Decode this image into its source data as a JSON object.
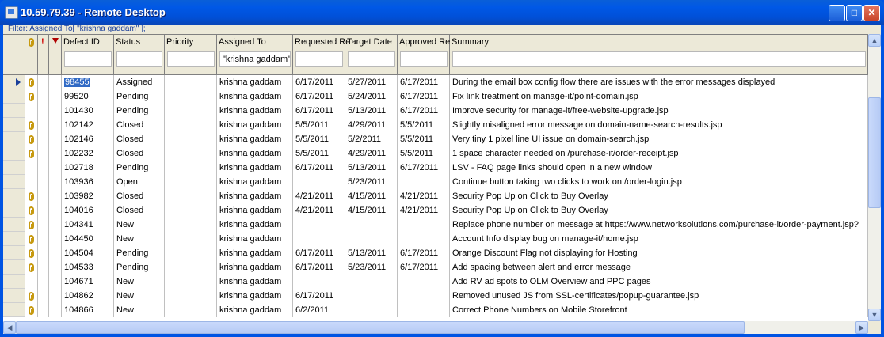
{
  "window": {
    "title": "10.59.79.39 - Remote Desktop",
    "minimize": "_",
    "maximize": "□",
    "close": "✕"
  },
  "filter": {
    "text": "Filter: Assigned To[ \"krishna gaddam\" ];"
  },
  "columns": [
    {
      "label": "",
      "icon": "attachment-icon"
    },
    {
      "label": "!",
      "icon": "priority-icon"
    },
    {
      "label": "",
      "icon": "flag-icon"
    },
    {
      "label": "Defect ID",
      "filter": ""
    },
    {
      "label": "Status",
      "filter": ""
    },
    {
      "label": "Priority",
      "filter": ""
    },
    {
      "label": "Assigned To",
      "filter": "\"krishna gaddam\""
    },
    {
      "label": "Requested Re",
      "filter": ""
    },
    {
      "label": "Target Date",
      "filter": ""
    },
    {
      "label": "Approved Re",
      "filter": ""
    },
    {
      "label": "Summary",
      "filter": ""
    }
  ],
  "rows": [
    {
      "attach": true,
      "id": "98455",
      "status": "Assigned",
      "priority": "",
      "assigned": "krishna gaddam",
      "requested": "6/17/2011",
      "target": "5/27/2011",
      "approved": "6/17/2011",
      "summary": "During the email box config flow there are issues with the error messages displayed"
    },
    {
      "attach": true,
      "id": "99520",
      "status": "Pending",
      "priority": "",
      "assigned": "krishna gaddam",
      "requested": "6/17/2011",
      "target": "5/24/2011",
      "approved": "6/17/2011",
      "summary": "Fix link treatment on manage-it/point-domain.jsp"
    },
    {
      "attach": false,
      "id": "101430",
      "status": "Pending",
      "priority": "",
      "assigned": "krishna gaddam",
      "requested": "6/17/2011",
      "target": "5/13/2011",
      "approved": "6/17/2011",
      "summary": "Improve security for manage-it/free-website-upgrade.jsp"
    },
    {
      "attach": true,
      "id": "102142",
      "status": "Closed",
      "priority": "",
      "assigned": "krishna gaddam",
      "requested": "5/5/2011",
      "target": "4/29/2011",
      "approved": "5/5/2011",
      "summary": "Slightly misaligned error message on domain-name-search-results.jsp"
    },
    {
      "attach": true,
      "id": "102146",
      "status": "Closed",
      "priority": "",
      "assigned": "krishna gaddam",
      "requested": "5/5/2011",
      "target": "5/2/2011",
      "approved": "5/5/2011",
      "summary": "Very tiny 1 pixel line UI issue on domain-search.jsp"
    },
    {
      "attach": true,
      "id": "102232",
      "status": "Closed",
      "priority": "",
      "assigned": "krishna gaddam",
      "requested": "5/5/2011",
      "target": "4/29/2011",
      "approved": "5/5/2011",
      "summary": "1 space character needed on /purchase-it/order-receipt.jsp"
    },
    {
      "attach": false,
      "id": "102718",
      "status": "Pending",
      "priority": "",
      "assigned": "krishna gaddam",
      "requested": "6/17/2011",
      "target": "5/13/2011",
      "approved": "6/17/2011",
      "summary": "LSV - FAQ page links should open in a new window"
    },
    {
      "attach": false,
      "id": "103936",
      "status": "Open",
      "priority": "",
      "assigned": "krishna gaddam",
      "requested": "",
      "target": "5/23/2011",
      "approved": "",
      "summary": "Continue button taking two clicks to work on /order-login.jsp"
    },
    {
      "attach": true,
      "id": "103982",
      "status": "Closed",
      "priority": "",
      "assigned": "krishna gaddam",
      "requested": "4/21/2011",
      "target": "4/15/2011",
      "approved": "4/21/2011",
      "summary": "Security Pop Up on Click to Buy Overlay"
    },
    {
      "attach": true,
      "id": "104016",
      "status": "Closed",
      "priority": "",
      "assigned": "krishna gaddam",
      "requested": "4/21/2011",
      "target": "4/15/2011",
      "approved": "4/21/2011",
      "summary": "Security Pop Up on Click to Buy Overlay"
    },
    {
      "attach": true,
      "id": "104341",
      "status": "New",
      "priority": "",
      "assigned": "krishna gaddam",
      "requested": "",
      "target": "",
      "approved": "",
      "summary": "Replace phone number on message at https://www.networksolutions.com/purchase-it/order-payment.jsp?"
    },
    {
      "attach": true,
      "id": "104450",
      "status": "New",
      "priority": "",
      "assigned": "krishna gaddam",
      "requested": "",
      "target": "",
      "approved": "",
      "summary": "Account Info display bug on manage-it/home.jsp"
    },
    {
      "attach": true,
      "id": "104504",
      "status": "Pending",
      "priority": "",
      "assigned": "krishna gaddam",
      "requested": "6/17/2011",
      "target": "5/13/2011",
      "approved": "6/17/2011",
      "summary": "Orange Discount Flag not displaying for Hosting"
    },
    {
      "attach": true,
      "id": "104533",
      "status": "Pending",
      "priority": "",
      "assigned": "krishna gaddam",
      "requested": "6/17/2011",
      "target": "5/23/2011",
      "approved": "6/17/2011",
      "summary": "Add spacing between alert and error message"
    },
    {
      "attach": false,
      "id": "104671",
      "status": "New",
      "priority": "",
      "assigned": "krishna gaddam",
      "requested": "",
      "target": "",
      "approved": "",
      "summary": "Add RV ad spots to OLM Overview and PPC pages"
    },
    {
      "attach": true,
      "id": "104862",
      "status": "New",
      "priority": "",
      "assigned": "krishna gaddam",
      "requested": "6/17/2011",
      "target": "",
      "approved": "",
      "summary": "Removed unused JS from SSL-certificates/popup-guarantee.jsp"
    },
    {
      "attach": true,
      "id": "104866",
      "status": "New",
      "priority": "",
      "assigned": "krishna gaddam",
      "requested": "6/2/2011",
      "target": "",
      "approved": "",
      "summary": "Correct Phone Numbers on Mobile Storefront"
    }
  ],
  "selected_row_index": 0,
  "colors": {
    "titlebar": "#0054e3",
    "selection": "#316ac5",
    "header_bg": "#ece9d8",
    "attachment": "#c79a10"
  }
}
